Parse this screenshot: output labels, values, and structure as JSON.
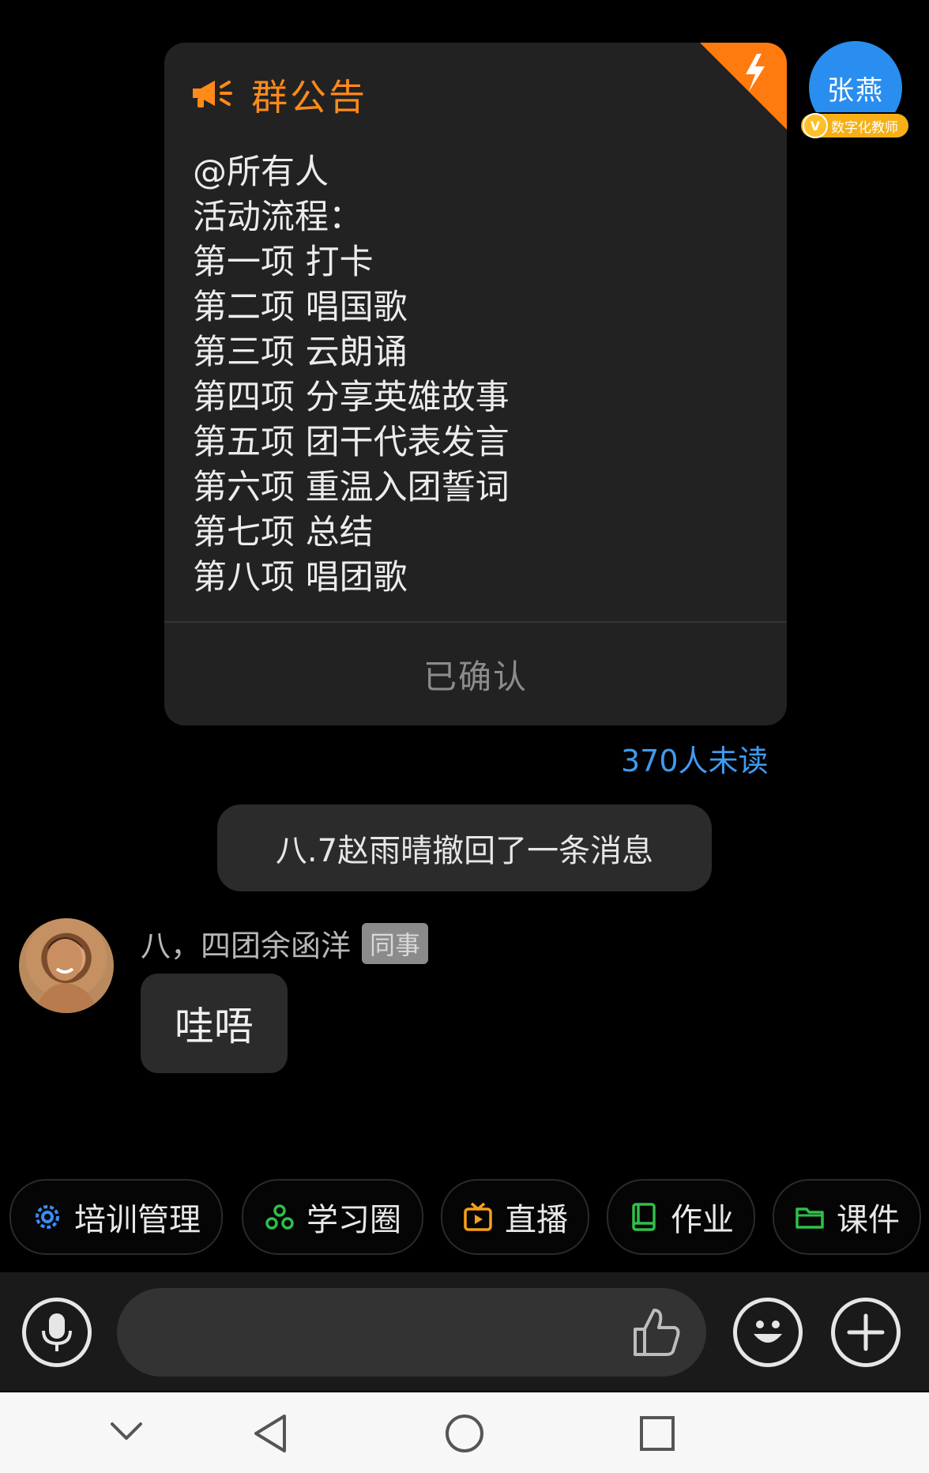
{
  "announcement": {
    "title": "群公告",
    "body": "@所有人\n活动流程：\n第一项  打卡\n第二项 唱国歌\n第三项 云朗诵\n第四项 分享英雄故事\n第五项 团干代表发言\n第六项 重温入团誓词\n第七项 总结\n第八项 唱团歌",
    "confirm_label": "已确认"
  },
  "sender": {
    "name": "张燕",
    "badge": "数字化教师",
    "badge_icon": "V"
  },
  "unread_text": "370人未读",
  "system_message": "八.7赵雨晴撤回了一条消息",
  "incoming": {
    "name": "八，四团余函洋",
    "tag": "同事",
    "text": "哇唔"
  },
  "quick_actions": [
    {
      "label": "培训管理",
      "icon": "gear-icon",
      "color": "#3b8cf5"
    },
    {
      "label": "学习圈",
      "icon": "circle-group-icon",
      "color": "#2fbf4a"
    },
    {
      "label": "直播",
      "icon": "tv-icon",
      "color": "#f6a019"
    },
    {
      "label": "作业",
      "icon": "book-icon",
      "color": "#2fbf4a"
    },
    {
      "label": "课件",
      "icon": "folder-icon",
      "color": "#2fbf4a"
    }
  ],
  "input": {
    "placeholder": ""
  },
  "colors": {
    "accent_orange": "#ff8a1a",
    "link_blue": "#3f9bf0",
    "avatar_blue": "#2a8ef0"
  }
}
